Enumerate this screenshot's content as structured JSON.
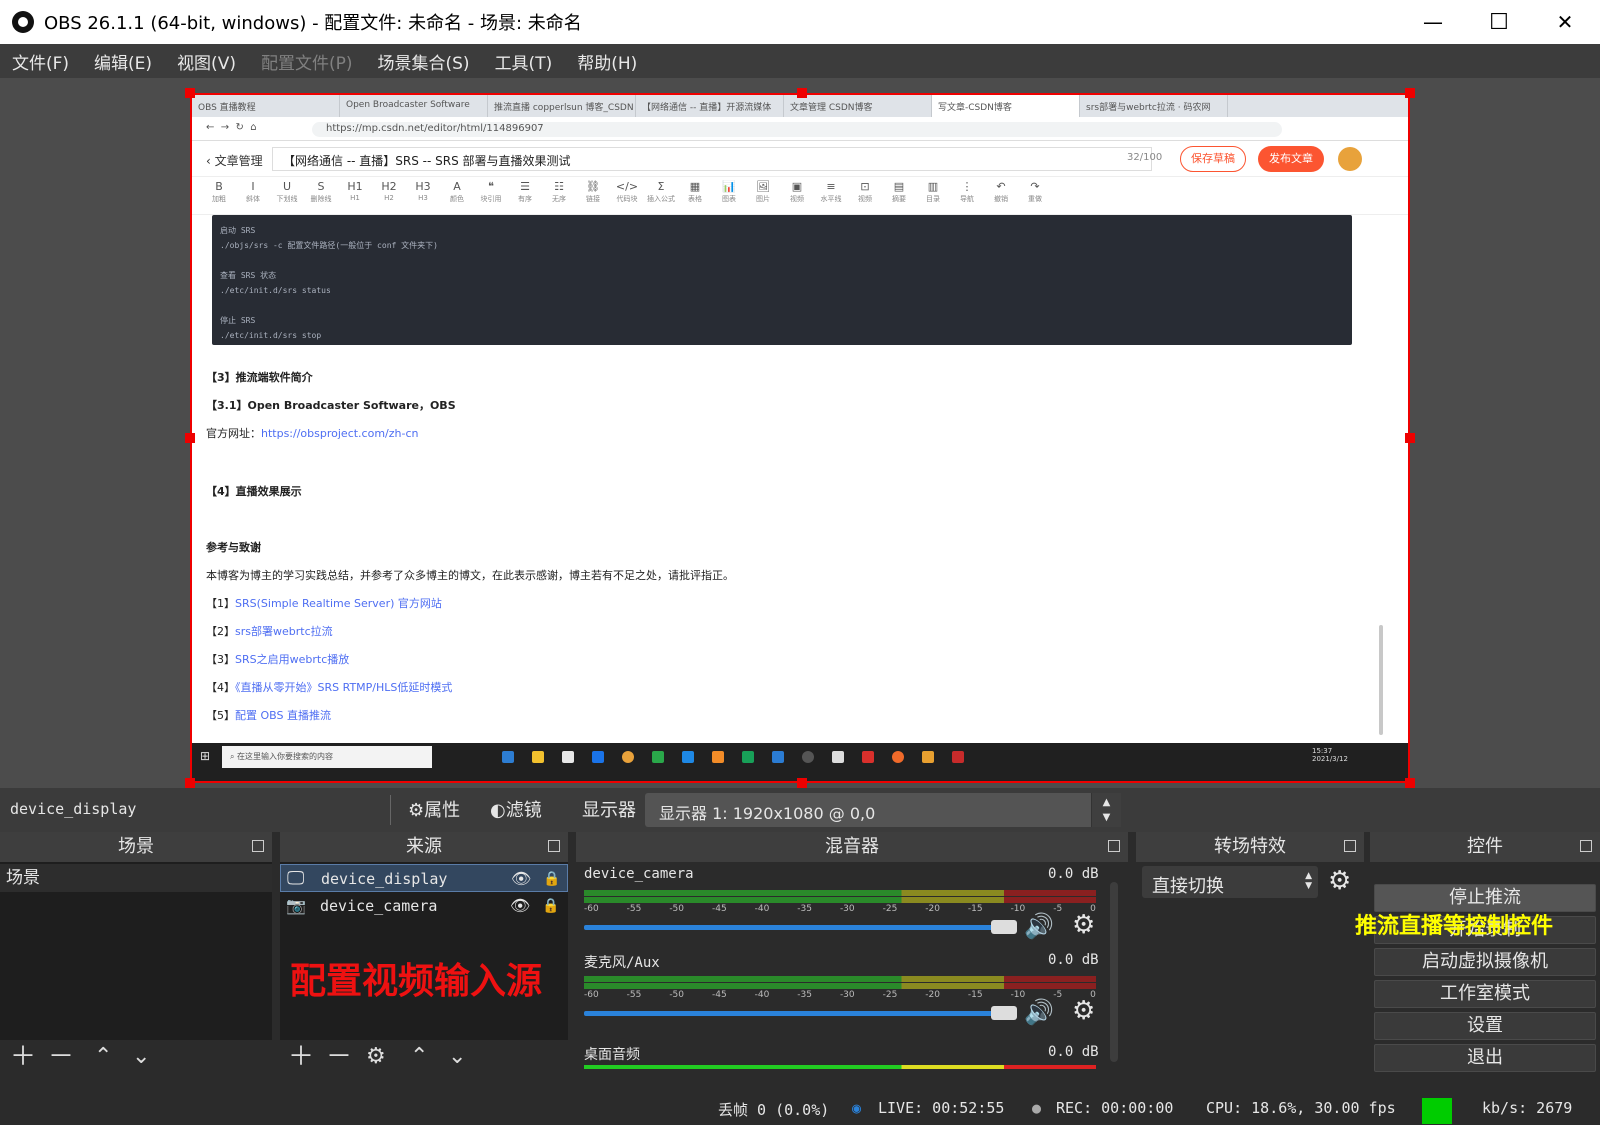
{
  "window": {
    "title": "OBS 26.1.1 (64-bit, windows) - 配置文件: 未命名 - 场景: 未命名",
    "min": "—",
    "max": "☐",
    "close": "✕"
  },
  "menu": [
    {
      "label": "文件(F)"
    },
    {
      "label": "编辑(E)"
    },
    {
      "label": "视图(V)"
    },
    {
      "label": "配置文件(P)"
    },
    {
      "label": "场景集合(S)"
    },
    {
      "label": "工具(T)"
    },
    {
      "label": "帮助(H)"
    }
  ],
  "preview": {
    "tabs": [
      "OBS 直播教程",
      "Open Broadcaster Software",
      "推流直播 copperlsun 博客_CSDN",
      "【网络通信 -- 直播】开源流媒体",
      "文章管理 CSDN博客",
      "写文章-CSDN博客",
      "srs部署与webrtc拉流 · 码农网"
    ],
    "url": "https://mp.csdn.net/editor/html/114896907",
    "back_label": "文章管理",
    "article_title": "【网络通信 -- 直播】SRS -- SRS 部署与直播效果测试",
    "title_count": "32/100",
    "draft_btn": "保存草稿",
    "publish_btn": "发布文章",
    "toolbar": [
      {
        "g": "B",
        "l": "加粗"
      },
      {
        "g": "I",
        "l": "斜体"
      },
      {
        "g": "U",
        "l": "下划线"
      },
      {
        "g": "S",
        "l": "删除线"
      },
      {
        "g": "H1",
        "l": "H1"
      },
      {
        "g": "H2",
        "l": "H2"
      },
      {
        "g": "H3",
        "l": "H3"
      },
      {
        "g": "A",
        "l": "颜色"
      },
      {
        "g": "❝",
        "l": "块引用"
      },
      {
        "g": "☰",
        "l": "有序"
      },
      {
        "g": "☷",
        "l": "无序"
      },
      {
        "g": "⛓",
        "l": "链接"
      },
      {
        "g": "</>",
        "l": "代码块"
      },
      {
        "g": "Σ",
        "l": "插入公式"
      },
      {
        "g": "▦",
        "l": "表格"
      },
      {
        "g": "📊",
        "l": "图表"
      },
      {
        "g": "🖼",
        "l": "图片"
      },
      {
        "g": "▣",
        "l": "视频"
      },
      {
        "g": "≡",
        "l": "水平线"
      },
      {
        "g": "⊡",
        "l": "视频"
      },
      {
        "g": "▤",
        "l": "摘要"
      },
      {
        "g": "▥",
        "l": "目录"
      },
      {
        "g": "⋮",
        "l": "导航"
      },
      {
        "g": "↶",
        "l": "撤销"
      },
      {
        "g": "↷",
        "l": "重做"
      }
    ],
    "code_lines": [
      "启动 SRS",
      "./objs/srs -c 配置文件路径(一般位于 conf 文件夹下)",
      "",
      "查看 SRS 状态",
      "./etc/init.d/srs status",
      "",
      "停止 SRS",
      "./etc/init.d/srs stop"
    ],
    "doc": {
      "h3": "【3】推流端软件简介",
      "h31": "【3.1】Open Broadcaster Software，OBS",
      "site_label": "官方网址：",
      "site_link": "https://obsproject.com/zh-cn",
      "h4": "【4】直播效果展示",
      "ref_head": "参考与致谢",
      "ref_text": "本博客为博主的学习实践总结，并参考了众多博主的博文，在此表示感谢，博主若有不足之处，请批评指正。",
      "refs": [
        {
          "n": "【1】",
          "t": "SRS(Simple Realtime Server) 官方网站"
        },
        {
          "n": "【2】",
          "t": "srs部署webrtc拉流"
        },
        {
          "n": "【3】",
          "t": "SRS之启用webrtc播放"
        },
        {
          "n": "【4】",
          "t": "《直播从零开始》SRS RTMP/HLS低延时模式"
        },
        {
          "n": "【5】",
          "t": "配置 OBS 直播推流"
        }
      ]
    },
    "taskbar_search": "在这里输入你要搜索的内容",
    "taskbar_time": "15:37",
    "taskbar_date": "2021/3/12"
  },
  "source_toolbar": {
    "selected": "device_display",
    "props": "属性",
    "filters": "滤镜",
    "display_label": "显示器",
    "display_value": "显示器 1: 1920x1080 @ 0,0"
  },
  "docks": {
    "scenes": {
      "title": "场景",
      "items": [
        "场景"
      ]
    },
    "sources": {
      "title": "来源",
      "items": [
        "device_display",
        "device_camera"
      ]
    },
    "mixer": {
      "title": "混音器",
      "channels": [
        {
          "name": "device_camera",
          "db": "0.0 dB",
          "level": 1.0
        },
        {
          "name": "麦克风/Aux",
          "db": "0.0 dB",
          "level": 1.0
        },
        {
          "name": "桌面音频",
          "db": "0.0 dB",
          "level": 1.0
        }
      ],
      "scale": [
        "-60",
        "-55",
        "-50",
        "-45",
        "-40",
        "-35",
        "-30",
        "-25",
        "-20",
        "-15",
        "-10",
        "-5",
        "0"
      ]
    },
    "transitions": {
      "title": "转场特效",
      "value": "直接切换"
    },
    "controls": {
      "title": "控件",
      "buttons": [
        "停止推流",
        "开始录制",
        "启动虚拟摄像机",
        "工作室模式",
        "设置",
        "退出"
      ]
    }
  },
  "annotations": {
    "sources": "配置视频输入源",
    "controls": "推流直播等控制控件"
  },
  "status": {
    "dropped": "丢帧 0 (0.0%)",
    "live": "LIVE: 00:52:55",
    "rec": "REC: 00:00:00",
    "cpu": "CPU: 18.6%, 30.00 fps",
    "kbps": "kb/s: 2679"
  },
  "colors": {
    "accent": "#2a82da",
    "selection_border": "#ee0000",
    "bitrate_ok": "#00cc00",
    "annotation_red": "#ee1111",
    "annotation_yellow": "#ffff00"
  }
}
